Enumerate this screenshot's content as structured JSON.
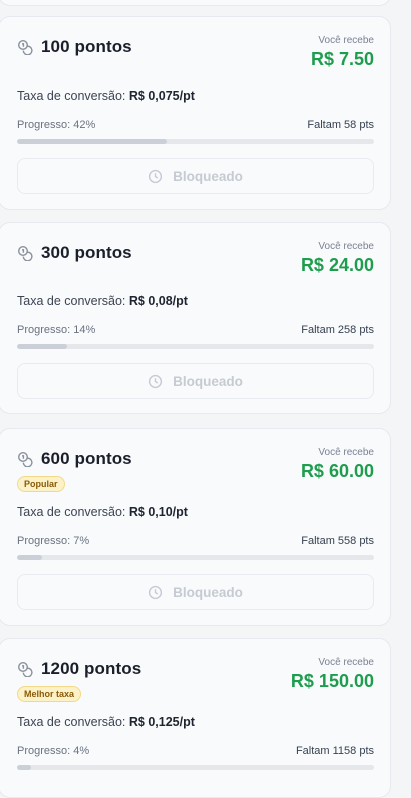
{
  "colors": {
    "accent_green": "#1f9d4e",
    "badge_bg": "#fdf2c7",
    "badge_text": "#8a5a08"
  },
  "icons": {
    "coins": "coins-icon",
    "lock_button": "clock-icon"
  },
  "labels": {
    "receive": "Você recebe",
    "rate": "Taxa de conversão:",
    "progress_prefix": "Progresso:",
    "remaining_prefix": "Faltam",
    "locked": "Bloqueado"
  },
  "tiers": [
    {
      "points": "100 pontos",
      "receive_value": "R$ 7.50",
      "rate_value": "R$ 0,075/pt",
      "progress_text": "Progresso: 42%",
      "progress": 0.42,
      "remaining_text": "Faltam 58 pts",
      "button": "Bloqueado",
      "badge": ""
    },
    {
      "points": "300 pontos",
      "receive_value": "R$ 24.00",
      "rate_value": "R$ 0,08/pt",
      "progress_text": "Progresso: 14%",
      "progress": 0.14,
      "remaining_text": "Faltam 258 pts",
      "button": "Bloqueado",
      "badge": ""
    },
    {
      "points": "600 pontos",
      "receive_value": "R$ 60.00",
      "rate_value": "R$ 0,10/pt",
      "progress_text": "Progresso: 7%",
      "progress": 0.07,
      "remaining_text": "Faltam 558 pts",
      "button": "Bloqueado",
      "badge": "Popular"
    },
    {
      "points": "1200 pontos",
      "receive_value": "R$ 150.00",
      "rate_value": "R$ 0,125/pt",
      "progress_text": "Progresso: 4%",
      "progress": 0.04,
      "remaining_text": "Faltam 1158 pts",
      "button": "Bloqueado",
      "badge": "Melhor taxa"
    }
  ]
}
